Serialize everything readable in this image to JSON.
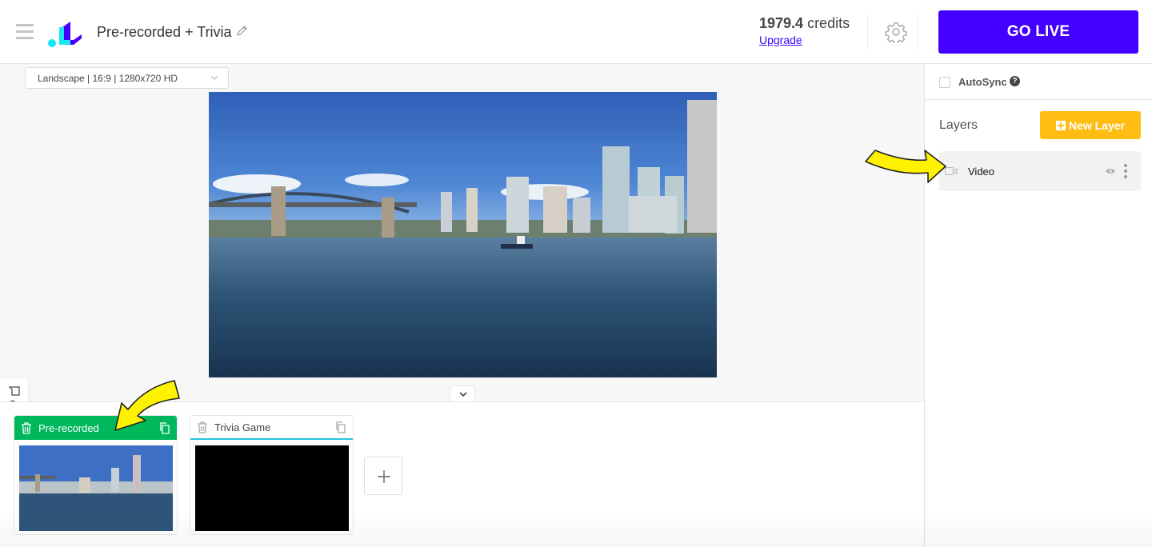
{
  "header": {
    "project_title": "Pre-recorded + Trivia",
    "credits_value": "1979.4",
    "credits_unit": " credits",
    "upgrade_label": "Upgrade",
    "go_live_label": "GO LIVE",
    "brand_color": "#4300ff"
  },
  "stage": {
    "format_selected": "Landscape | 16:9 | 1280x720 HD",
    "chat_label": "Chat"
  },
  "scenes": [
    {
      "name": "Pre-recorded",
      "active": true,
      "thumbnail": "city-waterfront-video"
    },
    {
      "name": "Trivia Game",
      "active": false,
      "thumbnail": "black"
    }
  ],
  "sidebar": {
    "autosync_label": "AutoSync",
    "autosync_checked": false,
    "help_glyph": "?",
    "layers_title": "Layers",
    "new_layer_label": "New Layer",
    "layers": [
      {
        "name": "Video",
        "icon": "video-camera-icon",
        "visible": true
      }
    ]
  },
  "colors": {
    "active_scene": "#00b85c",
    "new_layer": "#ffbd14",
    "inactive_scene_underline": "#27c3e0",
    "annotation_arrow": "#fff200"
  }
}
